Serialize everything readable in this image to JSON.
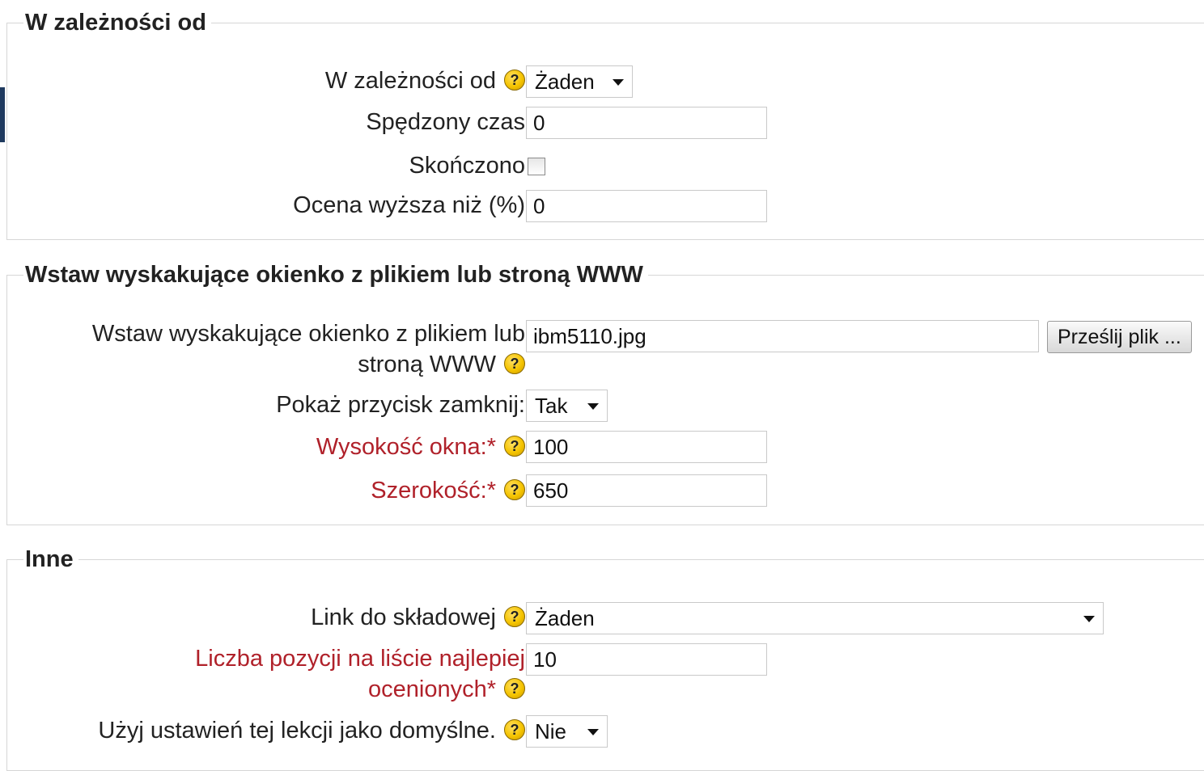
{
  "sections": {
    "dependency": {
      "legend": "W zależności od",
      "depends_on": {
        "label": "W zależności od",
        "value": "Żaden"
      },
      "time_spent": {
        "label": "Spędzony czas",
        "value": "0"
      },
      "completed": {
        "label": "Skończono",
        "checked": false
      },
      "grade_better": {
        "label": "Ocena wyższa niż (%)",
        "value": "0"
      }
    },
    "popup": {
      "legend": "Wstaw wyskakujące okienko z plikiem lub stroną WWW",
      "file": {
        "label_line1": "Wstaw wyskakujące okienko z plikiem lub",
        "label_line2": "stroną WWW",
        "value": "ibm5110.jpg",
        "upload_button": "Prześlij plik ..."
      },
      "show_close": {
        "label": "Pokaż przycisk zamknij:",
        "value": "Tak"
      },
      "window_height": {
        "label": "Wysokość okna:",
        "required": "*",
        "value": "100"
      },
      "width": {
        "label": "Szerokość:",
        "required": "*",
        "value": "650"
      }
    },
    "other": {
      "legend": "Inne",
      "activity_link": {
        "label": "Link do składowej",
        "value": "Żaden"
      },
      "max_high_scores": {
        "label_line1": "Liczba pozycji na liście najlepiej",
        "label_line2": "ocenionych",
        "required": "*",
        "value": "10"
      },
      "use_defaults": {
        "label": "Użyj ustawień tej lekcji jako domyślne.",
        "value": "Nie"
      }
    }
  },
  "help_glyph": "?",
  "icons": {
    "help": "help-icon",
    "dropdown": "chevron-down-icon"
  },
  "colors": {
    "required_label": "#b0212a",
    "help_icon": "#f5c400",
    "left_accent": "#1f3a5f"
  }
}
